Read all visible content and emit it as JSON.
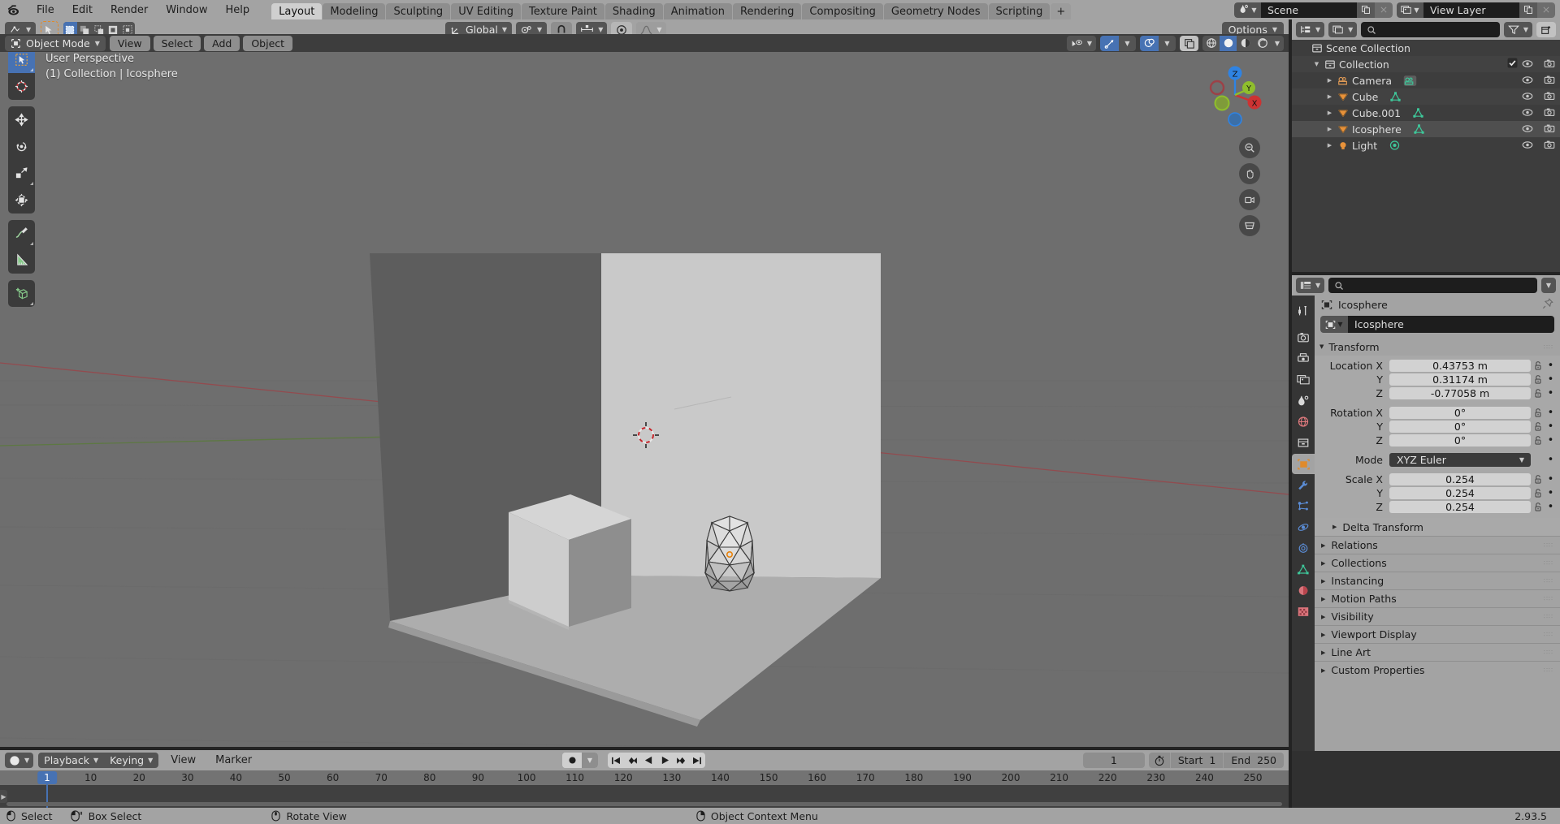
{
  "topbar": {
    "logo_icon": "blender-logo-icon",
    "menus": [
      "File",
      "Edit",
      "Render",
      "Window",
      "Help"
    ],
    "workspace_tabs": [
      {
        "label": "Layout",
        "active": true
      },
      {
        "label": "Modeling",
        "active": false
      },
      {
        "label": "Sculpting",
        "active": false
      },
      {
        "label": "UV Editing",
        "active": false
      },
      {
        "label": "Texture Paint",
        "active": false
      },
      {
        "label": "Shading",
        "active": false
      },
      {
        "label": "Animation",
        "active": false
      },
      {
        "label": "Rendering",
        "active": false
      },
      {
        "label": "Compositing",
        "active": false
      },
      {
        "label": "Geometry Nodes",
        "active": false
      },
      {
        "label": "Scripting",
        "active": false
      }
    ],
    "add_workspace_label": "+",
    "scene": {
      "icon": "scene-icon",
      "value": "Scene",
      "new_icon": "copy-icon",
      "unlink_icon": "x-icon"
    },
    "view_layer": {
      "icon": "view-layer-icon",
      "value": "View Layer",
      "new_icon": "copy-icon",
      "unlink_icon": "x-icon"
    }
  },
  "viewport_header": {
    "editor_type_icon": "editor-type-3dview-icon",
    "mode": "Object Mode",
    "mode_icon": "object-mode-icon",
    "menus": [
      "View",
      "Select",
      "Add",
      "Object"
    ],
    "select_tool_icon": "select-box-tool-icon",
    "select_modes": [
      "set",
      "extend",
      "subtract",
      "invert",
      "intersect"
    ],
    "transform_orientation": "Global",
    "orientation_icon": "orientation-axis-icon",
    "pivot_icon": "pivot-point-icon",
    "snap_magnet_icon": "snap-magnet-icon",
    "snap_target_icon": "snap-increment-icon",
    "proportional_icon": "proportional-edit-icon",
    "falloff_icon": "falloff-smooth-icon",
    "options_label": "Options",
    "visibility_icon": "object-visibility-icon",
    "gizmo_icon": "gizmo-icon",
    "overlays_icon": "overlays-icon",
    "xray_icon": "xray-toggle-icon",
    "shading_modes": [
      "wireframe",
      "solid",
      "material-preview",
      "rendered"
    ],
    "shading_active": "solid"
  },
  "viewport": {
    "perspective_label": "User Perspective",
    "scene_info": "(1) Collection | Icosphere",
    "tools": [
      {
        "name": "tweak-tool",
        "icon": "cursor-arrow-icon",
        "active": true
      },
      {
        "name": "cursor-tool",
        "icon": "3d-cursor-icon",
        "active": false
      },
      {
        "name": "move-tool",
        "icon": "move-arrows-icon",
        "active": false
      },
      {
        "name": "rotate-tool",
        "icon": "rotate-icon",
        "active": false
      },
      {
        "name": "scale-tool",
        "icon": "scale-icon",
        "active": false
      },
      {
        "name": "transform-tool",
        "icon": "transform-icon",
        "active": false
      },
      {
        "name": "annotate-tool",
        "icon": "annotate-pencil-icon",
        "active": false
      },
      {
        "name": "measure-tool",
        "icon": "measure-ruler-icon",
        "active": false
      },
      {
        "name": "add-cube-tool",
        "icon": "add-cube-icon",
        "active": false
      }
    ],
    "gizmo_axes": [
      "X",
      "Y",
      "Z"
    ],
    "nav_buttons": [
      "zoom-icon",
      "pan-hand-icon",
      "camera-view-icon",
      "toggle-perspective-icon"
    ],
    "colors": {
      "background": "#6e6e6e",
      "x_axis": "#9c3a3a",
      "y_axis": "#4e7c32",
      "axis_x": "#cc3333",
      "axis_y": "#8fbe2c",
      "axis_z": "#2f83e3"
    }
  },
  "outliner": {
    "display_mode_icon": "outliner-icon",
    "filter_id_icon": "filter-id-icon",
    "search_placeholder": "",
    "search_icon": "search-icon",
    "filter_icon": "funnel-filter-icon",
    "new_collection_icon": "new-collection-icon",
    "rows": [
      {
        "name": "Scene Collection",
        "icon": "collection-icon",
        "indent": 0,
        "expandable": false,
        "expanded": false,
        "selected": false,
        "data_icon": "",
        "checkbox": false,
        "eye": false,
        "camera": false
      },
      {
        "name": "Collection",
        "icon": "collection-icon",
        "indent": 1,
        "expandable": true,
        "expanded": true,
        "selected": false,
        "data_icon": "",
        "checkbox": true,
        "eye": true,
        "camera": true
      },
      {
        "name": "Camera",
        "icon": "camera-object-icon",
        "indent": 2,
        "expandable": true,
        "expanded": false,
        "selected": false,
        "data_icon": "camera-data-icon",
        "checkbox": false,
        "eye": true,
        "camera": true
      },
      {
        "name": "Cube",
        "icon": "mesh-object-icon",
        "indent": 2,
        "expandable": true,
        "expanded": false,
        "selected": false,
        "data_icon": "mesh-data-icon",
        "checkbox": false,
        "eye": true,
        "camera": true
      },
      {
        "name": "Cube.001",
        "icon": "mesh-object-icon",
        "indent": 2,
        "expandable": true,
        "expanded": false,
        "selected": false,
        "data_icon": "mesh-data-icon",
        "checkbox": false,
        "eye": true,
        "camera": true
      },
      {
        "name": "Icosphere",
        "icon": "mesh-object-icon",
        "indent": 2,
        "expandable": true,
        "expanded": false,
        "selected": true,
        "data_icon": "mesh-data-icon",
        "checkbox": false,
        "eye": true,
        "camera": true
      },
      {
        "name": "Light",
        "icon": "light-object-icon",
        "indent": 2,
        "expandable": true,
        "expanded": false,
        "selected": false,
        "data_icon": "light-data-icon",
        "checkbox": false,
        "eye": true,
        "camera": true
      }
    ]
  },
  "properties": {
    "header": {
      "editor_icon": "properties-editor-icon",
      "search_placeholder": "",
      "search_icon": "search-icon"
    },
    "tabs": [
      {
        "name": "tool",
        "icon": "tool-wrench-screwdriver-icon",
        "selected": false
      },
      {
        "name": "render",
        "icon": "render-camera-icon",
        "selected": false
      },
      {
        "name": "output",
        "icon": "output-printer-icon",
        "selected": false
      },
      {
        "name": "view-layer",
        "icon": "view-layer-images-icon",
        "selected": false
      },
      {
        "name": "scene",
        "icon": "scene-cone-icon",
        "selected": false
      },
      {
        "name": "world",
        "icon": "world-globe-icon",
        "selected": false
      },
      {
        "name": "collection",
        "icon": "collection-box-icon",
        "selected": false
      },
      {
        "name": "object",
        "icon": "object-orange-square-icon",
        "selected": true
      },
      {
        "name": "modifiers",
        "icon": "wrench-icon",
        "selected": false
      },
      {
        "name": "particles",
        "icon": "particles-icon",
        "selected": false
      },
      {
        "name": "physics",
        "icon": "physics-orbit-icon",
        "selected": false
      },
      {
        "name": "constraints",
        "icon": "constraints-icon",
        "selected": false
      },
      {
        "name": "object-data",
        "icon": "mesh-data-green-icon",
        "selected": false
      },
      {
        "name": "material",
        "icon": "material-sphere-icon",
        "selected": false
      },
      {
        "name": "texture",
        "icon": "texture-checker-icon",
        "selected": false
      }
    ],
    "breadcrumb": {
      "icon": "object-icon",
      "label": "Icosphere",
      "pin_icon": "pin-icon"
    },
    "id_block": {
      "icon": "object-icon",
      "name": "Icosphere"
    },
    "transform_panel": {
      "title": "Transform",
      "expanded": true,
      "rows": [
        {
          "label": "Location X",
          "value": "0.43753 m",
          "lock": "unlocked",
          "animate": true
        },
        {
          "label": "Y",
          "value": "0.31174 m",
          "lock": "unlocked",
          "animate": true
        },
        {
          "label": "Z",
          "value": "-0.77058 m",
          "lock": "unlocked",
          "animate": true
        }
      ],
      "rotation_rows": [
        {
          "label": "Rotation X",
          "value": "0°",
          "lock": "unlocked",
          "animate": true
        },
        {
          "label": "Y",
          "value": "0°",
          "lock": "unlocked",
          "animate": true
        },
        {
          "label": "Z",
          "value": "0°",
          "lock": "unlocked",
          "animate": true
        }
      ],
      "mode_row": {
        "label": "Mode",
        "value": "XYZ Euler",
        "animate": true
      },
      "scale_rows": [
        {
          "label": "Scale X",
          "value": "0.254",
          "lock": "unlocked",
          "animate": true
        },
        {
          "label": "Y",
          "value": "0.254",
          "lock": "unlocked",
          "animate": true
        },
        {
          "label": "Z",
          "value": "0.254",
          "lock": "unlocked",
          "animate": true
        }
      ],
      "delta_transform": "Delta Transform"
    },
    "closed_panels": [
      "Relations",
      "Collections",
      "Instancing",
      "Motion Paths",
      "Visibility",
      "Viewport Display",
      "Line Art",
      "Custom Properties"
    ]
  },
  "timeline": {
    "editor_icon": "timeline-editor-icon",
    "menus": [
      "Playback",
      "Keying",
      "View",
      "Marker"
    ],
    "record_icon": "auto-keying-record-icon",
    "transport": [
      "jump-start-icon",
      "prev-keyframe-icon",
      "play-reverse-icon",
      "play-icon",
      "next-keyframe-icon",
      "jump-end-icon"
    ],
    "current_frame": "1",
    "use_preview_icon": "stopwatch-icon",
    "start_label": "Start",
    "start_value": "1",
    "end_label": "End",
    "end_value": "250",
    "playhead_frame": "1",
    "ticks": [
      10,
      20,
      30,
      40,
      50,
      60,
      70,
      80,
      90,
      100,
      110,
      120,
      130,
      140,
      150,
      160,
      170,
      180,
      190,
      200,
      210,
      220,
      230,
      240,
      250
    ]
  },
  "statusbar": {
    "items": [
      {
        "icon": "mouse-left-icon",
        "label": "Select"
      },
      {
        "icon": "mouse-left-drag-icon",
        "label": "Box Select"
      },
      {
        "icon": "mouse-middle-icon",
        "label": "Rotate View"
      },
      {
        "icon": "mouse-right-icon",
        "label": "Object Context Menu"
      }
    ],
    "version": "2.93.5"
  }
}
